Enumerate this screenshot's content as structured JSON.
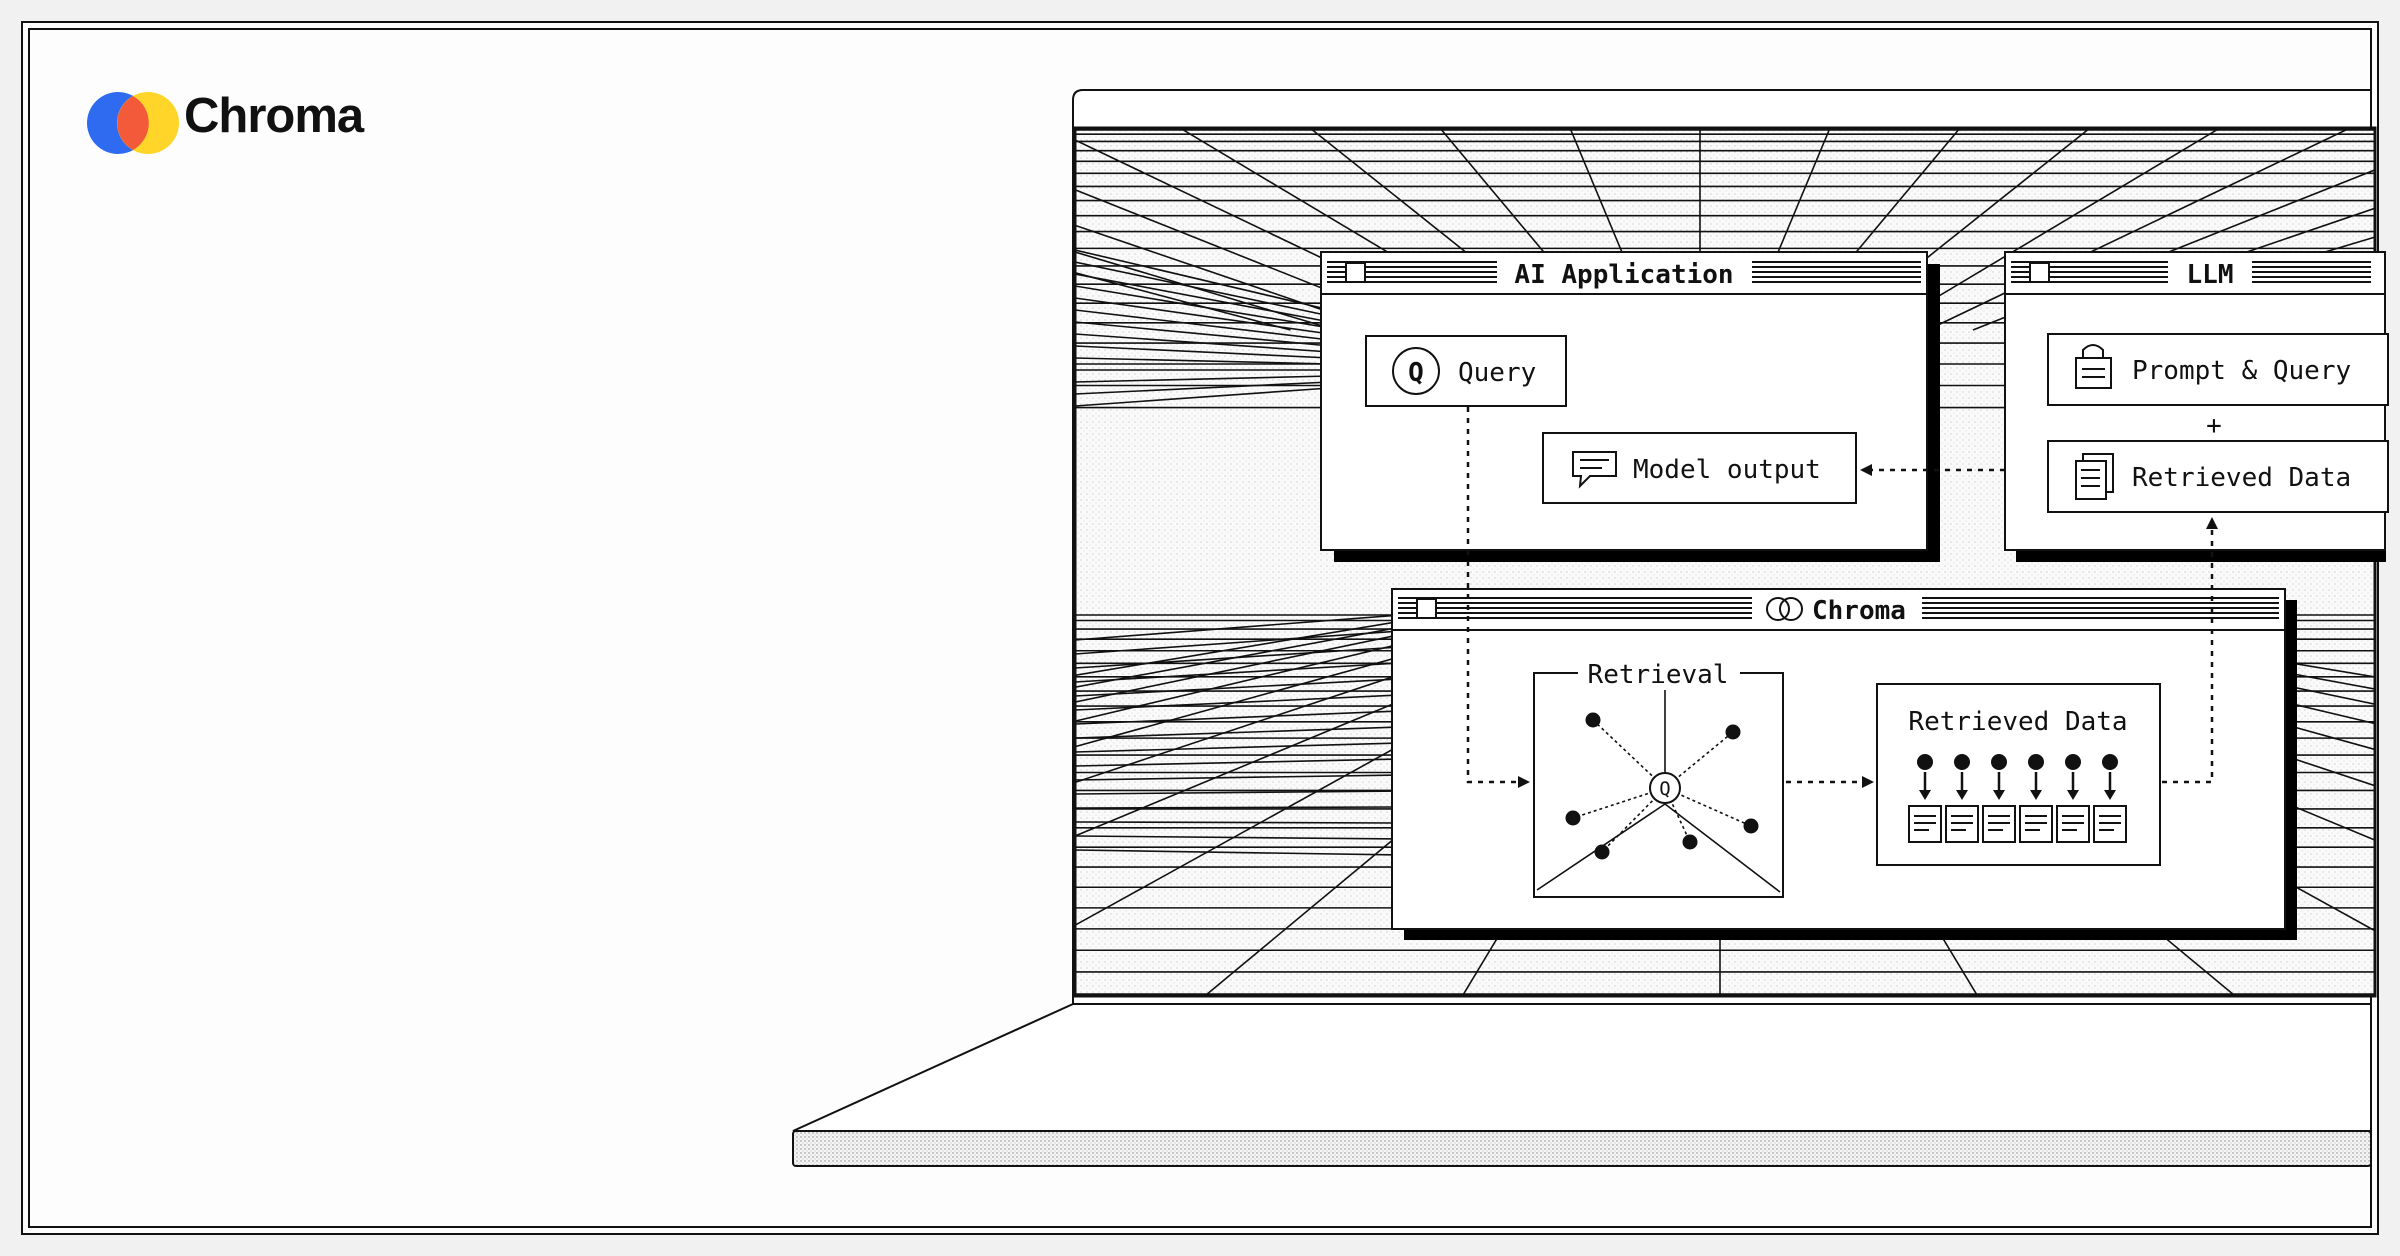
{
  "brand": {
    "name": "Chroma",
    "logo_colors": [
      "#2f6bf0",
      "#f25a3a",
      "#ffd52a"
    ]
  },
  "windows": {
    "ai_app": {
      "title": "AI Application"
    },
    "llm": {
      "title": "LLM"
    },
    "chroma": {
      "title": "Chroma"
    }
  },
  "nodes": {
    "query": "Query",
    "model_output": "Model output",
    "prompt_query": "Prompt & Query",
    "plus": "+",
    "retrieved_data_llm": "Retrieved Data",
    "retrieval": "Retrieval",
    "retrieved_data_chroma": "Retrieved Data",
    "retrieval_center": "Q",
    "query_icon_letter": "Q"
  },
  "icons": [
    "chroma-logo-icon",
    "query-q-icon",
    "chat-bubble-icon",
    "lock-document-icon",
    "documents-icon",
    "chroma-mini-icon",
    "window-close-box-icon"
  ],
  "retrieved_items_count": 6,
  "retrieval_points": 7
}
